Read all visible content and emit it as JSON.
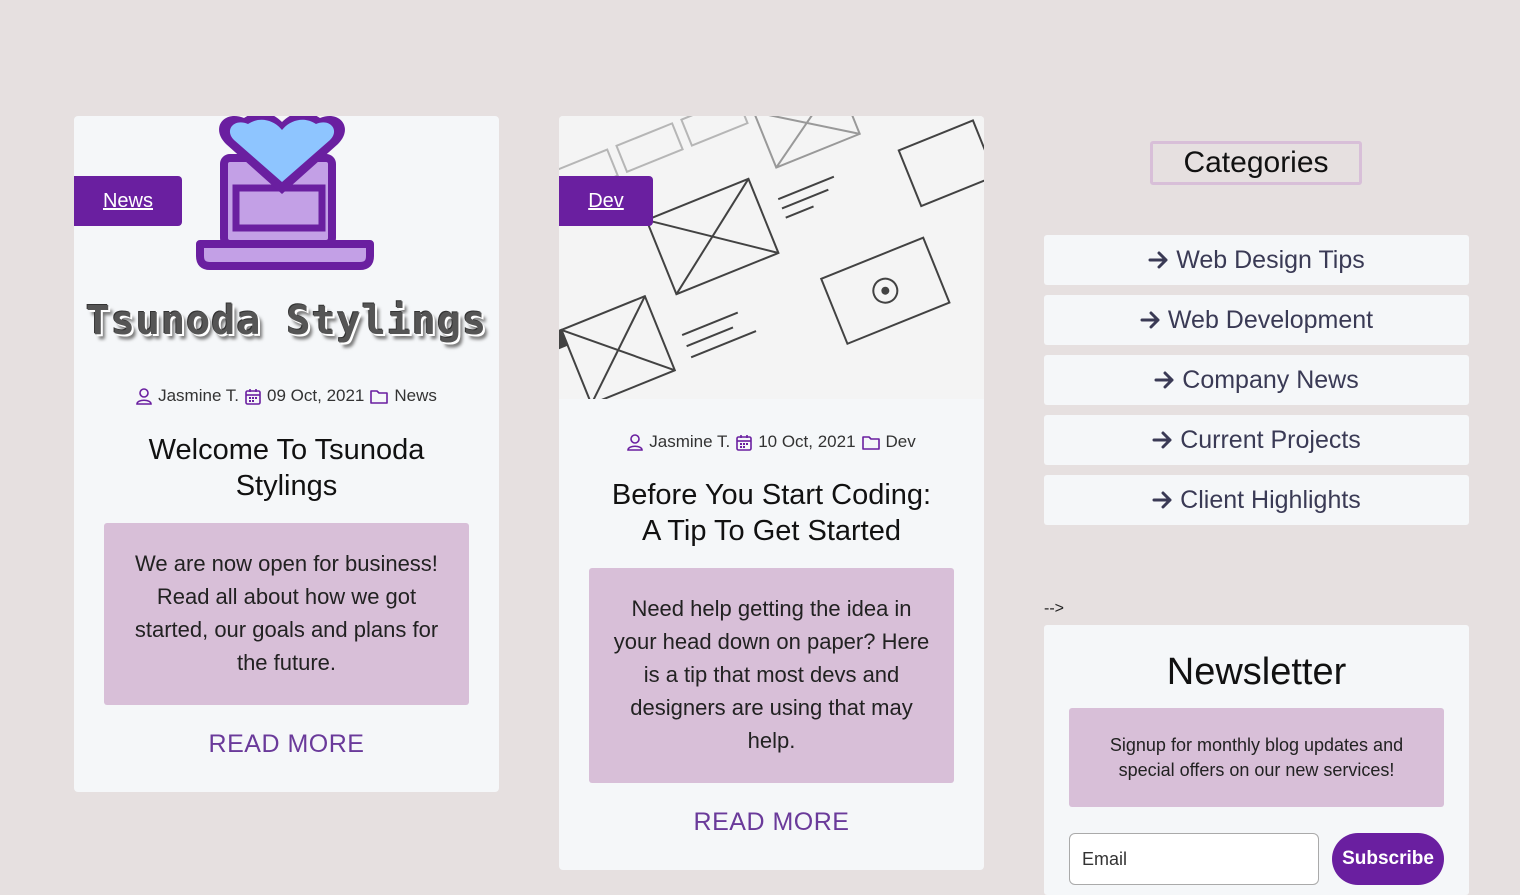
{
  "posts": [
    {
      "tag": "News",
      "brand_text": "Tsunoda Stylings",
      "author": "Jasmine T.",
      "date": "09 Oct, 2021",
      "category": "News",
      "title": "Welcome To Tsunoda Stylings",
      "excerpt": "We are now open for business! Read all about how we got started, our goals and plans for the future.",
      "read_more": "READ MORE"
    },
    {
      "tag": "Dev",
      "author": "Jasmine T.",
      "date": "10 Oct, 2021",
      "category": "Dev",
      "title": "Before You Start Coding: A Tip To Get Started",
      "excerpt": "Need help getting the idea in your head down on paper? Here is a tip that most devs and designers are using that may help.",
      "read_more": "READ MORE"
    }
  ],
  "sidebar": {
    "categories_title": "Categories",
    "categories": [
      "Web Design Tips",
      "Web Development",
      "Company News",
      "Current Projects",
      "Client Highlights"
    ],
    "stray_text": "-->",
    "newsletter": {
      "title": "Newsletter",
      "description": "Signup for monthly blog updates and special offers on our new services!",
      "email_placeholder": "Email",
      "subscribe_label": "Subscribe"
    }
  },
  "colors": {
    "accent": "#6a1fa0",
    "excerpt_bg": "#d8bfd8",
    "page_bg": "#e6e0e0",
    "card_bg": "#f5f7f9"
  }
}
